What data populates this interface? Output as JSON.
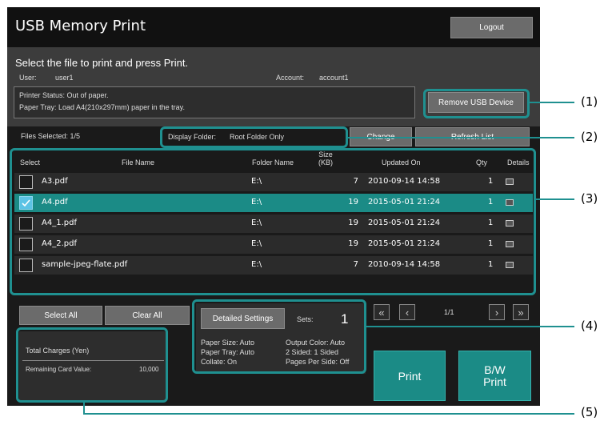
{
  "header": {
    "title": "USB Memory Print",
    "logout_label": "Logout"
  },
  "instructions": "Select the file to print and press Print.",
  "user": {
    "label": "User:",
    "value": "user1"
  },
  "account": {
    "label": "Account:",
    "value": "account1"
  },
  "printer_status": {
    "line1": "Printer Status: Out of paper.",
    "line2": "Paper Tray: Load A4(210x297mm) paper in the tray."
  },
  "remove_usb_label": "Remove USB Device",
  "files_selected": "Files Selected: 1/5",
  "display_folder": {
    "label": "Display Folder:",
    "value": "Root Folder Only"
  },
  "change_label": "Change",
  "refresh_label": "Refresh List",
  "columns": {
    "select": "Select",
    "file_name": "File Name",
    "folder_name": "Folder Name",
    "size": "Size\n(KB)",
    "updated_on": "Updated On",
    "qty": "Qty",
    "details": "Details"
  },
  "files": [
    {
      "name": "A3.pdf",
      "folder": "E:\\",
      "size": "7",
      "updated": "2010-09-14 14:58",
      "qty": "1",
      "selected": false
    },
    {
      "name": "A4.pdf",
      "folder": "E:\\",
      "size": "19",
      "updated": "2015-05-01 21:24",
      "qty": "1",
      "selected": true
    },
    {
      "name": "A4_1.pdf",
      "folder": "E:\\",
      "size": "19",
      "updated": "2015-05-01 21:24",
      "qty": "1",
      "selected": false
    },
    {
      "name": "A4_2.pdf",
      "folder": "E:\\",
      "size": "19",
      "updated": "2015-05-01 21:24",
      "qty": "1",
      "selected": false
    },
    {
      "name": "sample-jpeg-flate.pdf",
      "folder": "E:\\",
      "size": "7",
      "updated": "2010-09-14 14:58",
      "qty": "1",
      "selected": false
    }
  ],
  "select_all_label": "Select All",
  "clear_all_label": "Clear All",
  "detailed_settings_label": "Detailed Settings",
  "sets": {
    "label": "Sets:",
    "value": "1"
  },
  "settings": {
    "paper_size": "Paper Size: Auto",
    "output_color": "Output Color: Auto",
    "paper_tray": "Paper Tray: Auto",
    "two_sided": "2 Sided: 1 Sided",
    "collate": "Collate: On",
    "pages_per_side": "Pages Per Side: Off"
  },
  "pagination": {
    "page": "1/1",
    "first": "«",
    "prev": "‹",
    "next": "›",
    "last": "»"
  },
  "charges": {
    "title": "Total Charges (Yen)",
    "remaining_label": "Remaining Card Value:",
    "remaining_value": "10,000"
  },
  "print_label": "Print",
  "bw_print_label": "B/W\nPrint",
  "callouts": [
    "(1)",
    "(2)",
    "(3)",
    "(4)",
    "(5)"
  ],
  "colors": {
    "accent": "#1b8b86",
    "callout": "#1f9090",
    "background": "#1a1a1a"
  },
  "icons": {
    "details": "document-icon",
    "checkbox_on": "check-icon"
  }
}
